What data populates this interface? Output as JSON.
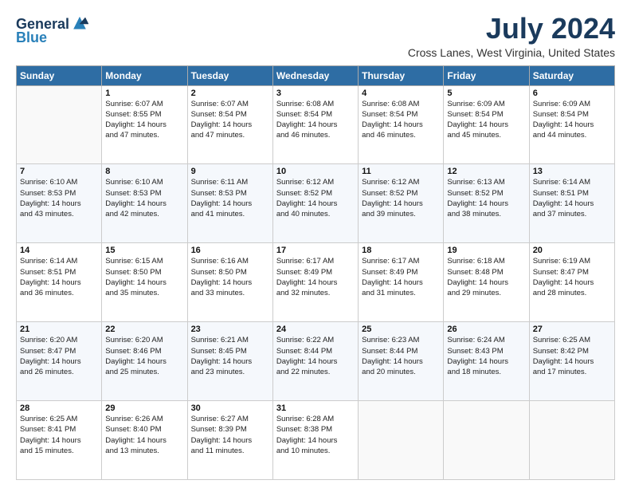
{
  "logo": {
    "line1": "General",
    "line2": "Blue"
  },
  "title": "July 2024",
  "location": "Cross Lanes, West Virginia, United States",
  "weekdays": [
    "Sunday",
    "Monday",
    "Tuesday",
    "Wednesday",
    "Thursday",
    "Friday",
    "Saturday"
  ],
  "weeks": [
    [
      {
        "day": "",
        "info": ""
      },
      {
        "day": "1",
        "info": "Sunrise: 6:07 AM\nSunset: 8:55 PM\nDaylight: 14 hours\nand 47 minutes."
      },
      {
        "day": "2",
        "info": "Sunrise: 6:07 AM\nSunset: 8:54 PM\nDaylight: 14 hours\nand 47 minutes."
      },
      {
        "day": "3",
        "info": "Sunrise: 6:08 AM\nSunset: 8:54 PM\nDaylight: 14 hours\nand 46 minutes."
      },
      {
        "day": "4",
        "info": "Sunrise: 6:08 AM\nSunset: 8:54 PM\nDaylight: 14 hours\nand 46 minutes."
      },
      {
        "day": "5",
        "info": "Sunrise: 6:09 AM\nSunset: 8:54 PM\nDaylight: 14 hours\nand 45 minutes."
      },
      {
        "day": "6",
        "info": "Sunrise: 6:09 AM\nSunset: 8:54 PM\nDaylight: 14 hours\nand 44 minutes."
      }
    ],
    [
      {
        "day": "7",
        "info": "Sunrise: 6:10 AM\nSunset: 8:53 PM\nDaylight: 14 hours\nand 43 minutes."
      },
      {
        "day": "8",
        "info": "Sunrise: 6:10 AM\nSunset: 8:53 PM\nDaylight: 14 hours\nand 42 minutes."
      },
      {
        "day": "9",
        "info": "Sunrise: 6:11 AM\nSunset: 8:53 PM\nDaylight: 14 hours\nand 41 minutes."
      },
      {
        "day": "10",
        "info": "Sunrise: 6:12 AM\nSunset: 8:52 PM\nDaylight: 14 hours\nand 40 minutes."
      },
      {
        "day": "11",
        "info": "Sunrise: 6:12 AM\nSunset: 8:52 PM\nDaylight: 14 hours\nand 39 minutes."
      },
      {
        "day": "12",
        "info": "Sunrise: 6:13 AM\nSunset: 8:52 PM\nDaylight: 14 hours\nand 38 minutes."
      },
      {
        "day": "13",
        "info": "Sunrise: 6:14 AM\nSunset: 8:51 PM\nDaylight: 14 hours\nand 37 minutes."
      }
    ],
    [
      {
        "day": "14",
        "info": "Sunrise: 6:14 AM\nSunset: 8:51 PM\nDaylight: 14 hours\nand 36 minutes."
      },
      {
        "day": "15",
        "info": "Sunrise: 6:15 AM\nSunset: 8:50 PM\nDaylight: 14 hours\nand 35 minutes."
      },
      {
        "day": "16",
        "info": "Sunrise: 6:16 AM\nSunset: 8:50 PM\nDaylight: 14 hours\nand 33 minutes."
      },
      {
        "day": "17",
        "info": "Sunrise: 6:17 AM\nSunset: 8:49 PM\nDaylight: 14 hours\nand 32 minutes."
      },
      {
        "day": "18",
        "info": "Sunrise: 6:17 AM\nSunset: 8:49 PM\nDaylight: 14 hours\nand 31 minutes."
      },
      {
        "day": "19",
        "info": "Sunrise: 6:18 AM\nSunset: 8:48 PM\nDaylight: 14 hours\nand 29 minutes."
      },
      {
        "day": "20",
        "info": "Sunrise: 6:19 AM\nSunset: 8:47 PM\nDaylight: 14 hours\nand 28 minutes."
      }
    ],
    [
      {
        "day": "21",
        "info": "Sunrise: 6:20 AM\nSunset: 8:47 PM\nDaylight: 14 hours\nand 26 minutes."
      },
      {
        "day": "22",
        "info": "Sunrise: 6:20 AM\nSunset: 8:46 PM\nDaylight: 14 hours\nand 25 minutes."
      },
      {
        "day": "23",
        "info": "Sunrise: 6:21 AM\nSunset: 8:45 PM\nDaylight: 14 hours\nand 23 minutes."
      },
      {
        "day": "24",
        "info": "Sunrise: 6:22 AM\nSunset: 8:44 PM\nDaylight: 14 hours\nand 22 minutes."
      },
      {
        "day": "25",
        "info": "Sunrise: 6:23 AM\nSunset: 8:44 PM\nDaylight: 14 hours\nand 20 minutes."
      },
      {
        "day": "26",
        "info": "Sunrise: 6:24 AM\nSunset: 8:43 PM\nDaylight: 14 hours\nand 18 minutes."
      },
      {
        "day": "27",
        "info": "Sunrise: 6:25 AM\nSunset: 8:42 PM\nDaylight: 14 hours\nand 17 minutes."
      }
    ],
    [
      {
        "day": "28",
        "info": "Sunrise: 6:25 AM\nSunset: 8:41 PM\nDaylight: 14 hours\nand 15 minutes."
      },
      {
        "day": "29",
        "info": "Sunrise: 6:26 AM\nSunset: 8:40 PM\nDaylight: 14 hours\nand 13 minutes."
      },
      {
        "day": "30",
        "info": "Sunrise: 6:27 AM\nSunset: 8:39 PM\nDaylight: 14 hours\nand 11 minutes."
      },
      {
        "day": "31",
        "info": "Sunrise: 6:28 AM\nSunset: 8:38 PM\nDaylight: 14 hours\nand 10 minutes."
      },
      {
        "day": "",
        "info": ""
      },
      {
        "day": "",
        "info": ""
      },
      {
        "day": "",
        "info": ""
      }
    ]
  ]
}
